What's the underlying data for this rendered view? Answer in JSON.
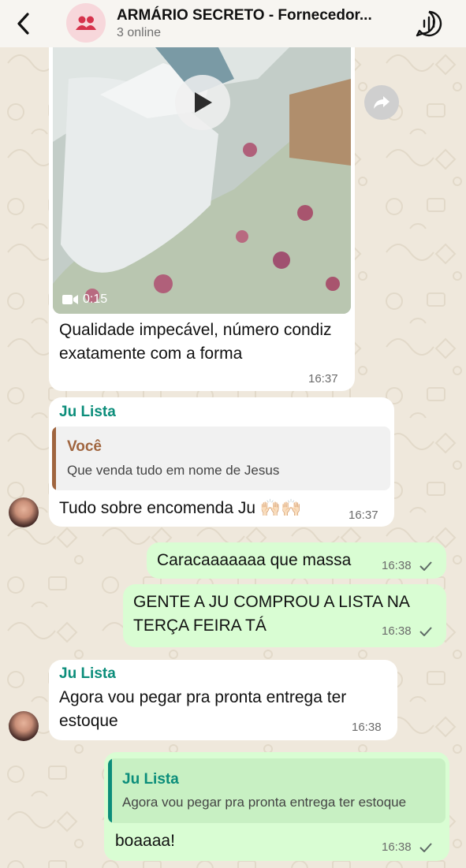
{
  "header": {
    "title": "ARMÁRIO SECRETO - Fornecedor...",
    "subtitle": "3 online"
  },
  "messages": [
    {
      "video_duration": "0:15",
      "text": "Qualidade impecável, número condiz exatamente com a forma",
      "time": "16:37"
    },
    {
      "sender": "Ju Lista",
      "quote_author": "Você",
      "quote_text": "Que venda tudo em nome de Jesus",
      "text": "Tudo sobre encomenda Ju 🙌🏻🙌🏻",
      "time": "16:37"
    },
    {
      "text": "Caracaaaaaaa que massa",
      "time": "16:38"
    },
    {
      "text": "GENTE A JU COMPROU A LISTA NA TERÇA FEIRA TÁ",
      "time": "16:38"
    },
    {
      "sender": "Ju Lista",
      "text": "Agora vou pegar pra pronta entrega ter estoque",
      "time": "16:38"
    },
    {
      "quote_author": "Ju Lista",
      "quote_text": "Agora vou pegar pra pronta entrega ter estoque",
      "text": "boaaaa!",
      "time": "16:38"
    }
  ],
  "colors": {
    "incoming_bubble": "#ffffff",
    "outgoing_bubble": "#d9fdd3",
    "sender_name": "#0b8d7a",
    "read_check": "#5f6b66",
    "header_bg": "#f7f5f1",
    "chat_bg": "#efe8dc"
  },
  "icons": [
    "back-chevron-icon",
    "group-avatar-icon",
    "call-waveform-icon",
    "play-icon",
    "video-camera-icon",
    "forward-icon",
    "check-icon"
  ]
}
